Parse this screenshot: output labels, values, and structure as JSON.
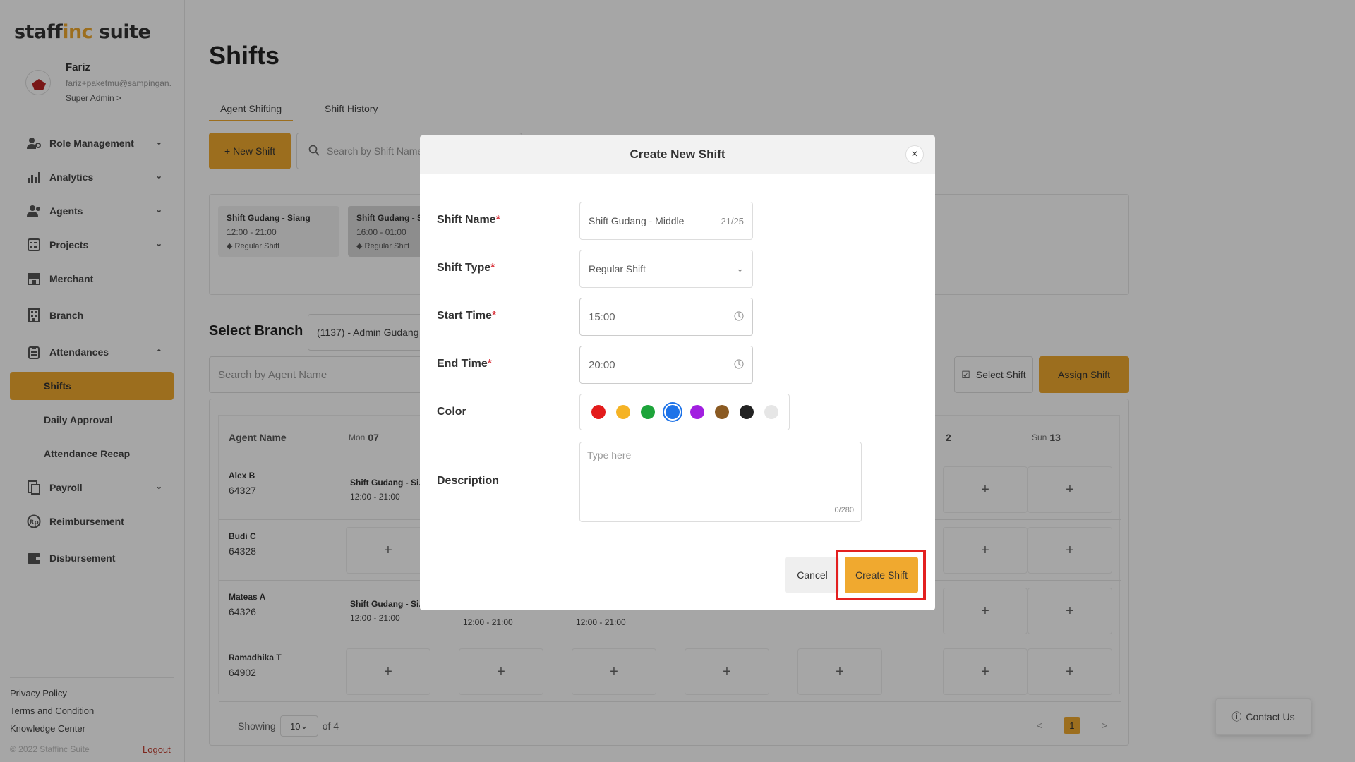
{
  "sidebar": {
    "logo": {
      "part1": "staff",
      "part2": "inc",
      "part3": " suite"
    },
    "profile": {
      "name": "Fariz",
      "email": "fariz+paketmu@sampingan.",
      "role": "Super Admin >"
    },
    "menu": [
      {
        "label": "Role Management",
        "icon": "user-gear-icon"
      },
      {
        "label": "Analytics",
        "icon": "bar-chart-icon"
      },
      {
        "label": "Agents",
        "icon": "users-icon"
      },
      {
        "label": "Projects",
        "icon": "list-icon"
      },
      {
        "label": "Merchant",
        "icon": "store-icon"
      },
      {
        "label": "Branch",
        "icon": "building-icon"
      },
      {
        "label": "Attendances",
        "icon": "clipboard-icon"
      },
      {
        "label": "Payroll",
        "icon": "payroll-icon"
      },
      {
        "label": "Reimbursement",
        "icon": "rupiah-icon"
      },
      {
        "label": "Disbursement",
        "icon": "wallet-icon"
      }
    ],
    "attendance_sub": [
      "Shifts",
      "Daily Approval",
      "Attendance Recap"
    ],
    "footer": {
      "privacy": "Privacy Policy",
      "terms": "Terms and Condition",
      "knowledge": "Knowledge Center",
      "copyright": "© 2022 Staffinc Suite",
      "logout": "Logout"
    }
  },
  "main": {
    "title": "Shifts",
    "tabs": [
      "Agent Shifting",
      "Shift History"
    ],
    "new_shift_btn": "+  New Shift",
    "search_shift_placeholder": "Search by Shift Name",
    "shift_cards": [
      {
        "name": "Shift Gudang - Siang",
        "time": "12:00 - 21:00",
        "type": "Regular Shift"
      },
      {
        "name": "Shift Gudang - S",
        "time": "16:00 - 01:00",
        "type": "Regular Shift"
      }
    ],
    "select_branch_label": "Select Branch",
    "branch_value": "(1137) - Admin Gudang",
    "search_agent_placeholder": "Search by Agent Name",
    "select_shift_btn": "Select Shift",
    "assign_shift_btn": "Assign Shift",
    "table": {
      "col_agent": "Agent Name",
      "col_mon_day": "Mon",
      "col_mon_num": "07",
      "col_sat_num": "2",
      "col_sun_day": "Sun",
      "col_sun_num": "13",
      "rows": [
        {
          "name": "Alex B",
          "id": "64327",
          "shift_name": "Shift Gudang - Si...",
          "shift_time": "12:00 - 21:00"
        },
        {
          "name": "Budi C",
          "id": "64328"
        },
        {
          "name": "Mateas A",
          "id": "64326",
          "shift_name": "Shift Gudang - Si...",
          "shift_time": "12:00 - 21:00",
          "t2": "12:00 - 21:00",
          "t3": "12:00 - 21:00"
        },
        {
          "name": "Ramadhika T",
          "id": "64902"
        }
      ],
      "plus": "+"
    },
    "pager": {
      "showing": "Showing",
      "per_page": "10",
      "of": "of 4",
      "current": "1",
      "prev": "<",
      "next": ">"
    },
    "contact_us": "Contact Us"
  },
  "modal": {
    "title": "Create New Shift",
    "close": "×",
    "shift_name_label": "Shift Name",
    "shift_name_value": "Shift Gudang - Middle",
    "shift_name_count": "21/25",
    "shift_type_label": "Shift Type",
    "shift_type_value": "Regular Shift",
    "start_time_label": "Start Time",
    "start_time_value": "15:00",
    "end_time_label": "End Time",
    "end_time_value": "20:00",
    "color_label": "Color",
    "colors": [
      "#E31B1B",
      "#F5B325",
      "#1DA43A",
      "#1E73E8",
      "#A11FE0",
      "#8A5A22",
      "#222222",
      "#E6E6E6"
    ],
    "selected_color_index": 3,
    "description_label": "Description",
    "description_placeholder": "Type here",
    "description_count": "0/280",
    "cancel_btn": "Cancel",
    "create_btn": "Create Shift",
    "required_mark": "*"
  }
}
